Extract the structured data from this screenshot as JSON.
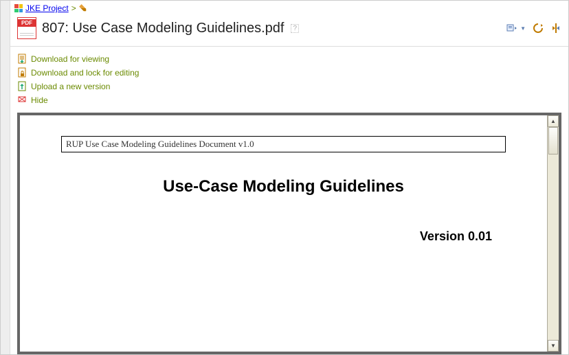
{
  "breadcrumb": {
    "project": "JKE Project",
    "separator": ">"
  },
  "document": {
    "title": "807: Use Case Modeling Guidelines.pdf",
    "help_marker": "?"
  },
  "actions": {
    "download_view": "Download for viewing",
    "download_lock": "Download and lock for editing",
    "upload": "Upload a new version",
    "hide": "Hide"
  },
  "embedded": {
    "boxed_header": "RUP Use Case Modeling Guidelines Document v1.0",
    "title": "Use-Case Modeling Guidelines",
    "version": "Version 0.01"
  },
  "scroll": {
    "up": "▲",
    "down": "▼"
  }
}
